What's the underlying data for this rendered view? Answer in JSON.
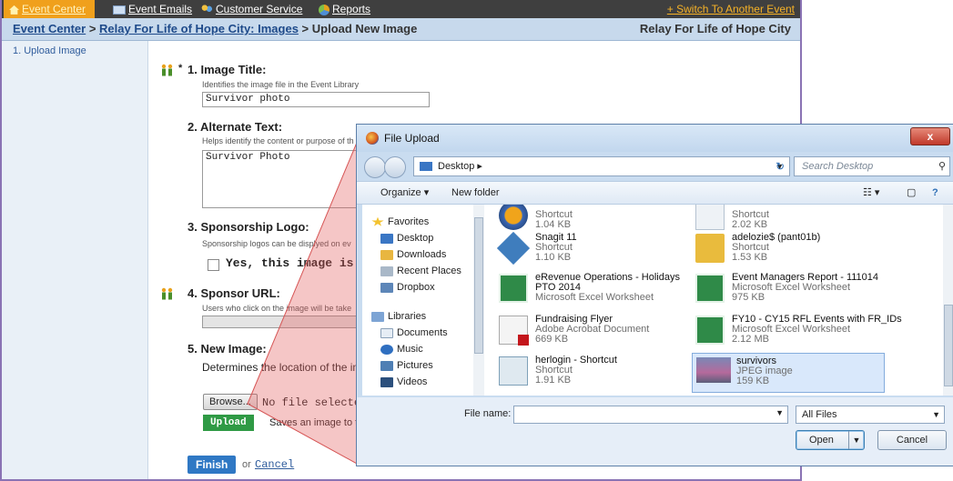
{
  "nav": {
    "items": [
      "Event Center",
      "Event Emails",
      "Customer Service",
      "Reports"
    ],
    "switch_label": "+ Switch To Another Event"
  },
  "breadcrumb": {
    "part1": "Event Center",
    "sep1": ">",
    "part2": "Relay For Life of Hope City: Images",
    "part3": "> Upload New Image",
    "event_name": "Relay For Life of Hope City"
  },
  "sidebar": {
    "items": [
      "1. Upload Image"
    ]
  },
  "form": {
    "f1_req": "*",
    "f1_label": "1. Image Title:",
    "f1_hint": "Identifies the image file in the Event Library",
    "f1_value": "Survivor photo",
    "f2_label": "2. Alternate Text:",
    "f2_hint": "Helps identify the content or purpose of th",
    "f2_value": "Survivor Photo",
    "f3_label": "3. Sponsorship Logo:",
    "f3_hint": "Sponsorship logos can be displyed on ev",
    "f3_checkbox": "Yes, this image is a spo",
    "f4_label": "4. Sponsor URL:",
    "f4_hint": "Users who click on the image will be take",
    "f5_label": "5. New Image:",
    "f5_hint": "Determines the location of the imag",
    "browse_label": "Browse...",
    "no_file": "No file selected.",
    "upload_label": "Upload",
    "upload_hint": "Saves an image to t",
    "finish_label": "Finish",
    "or_text": "or",
    "cancel_label": "Cancel"
  },
  "dialog": {
    "title": "File Upload",
    "close_label": "x",
    "address": "Desktop ▸",
    "search_placeholder": "Search Desktop",
    "organize_label": "Organize ▾",
    "new_folder_label": "New folder",
    "nav_pane": {
      "favorites": "Favorites",
      "items": [
        "Desktop",
        "Downloads",
        "Recent Places",
        "Dropbox"
      ],
      "libraries": "Libraries",
      "library_items": [
        "Documents",
        "Music",
        "Pictures",
        "Videos"
      ]
    },
    "files": [
      {
        "name": "",
        "type": "Shortcut",
        "size": "1.04 KB",
        "icon": "firefox-shortcut-icon"
      },
      {
        "name": "",
        "type": "Shortcut",
        "size": "2.02 KB",
        "icon": "shortcut-icon"
      },
      {
        "name": "Snagit 11",
        "type": "Shortcut",
        "size": "1.10 KB",
        "icon": "snagit-icon"
      },
      {
        "name": "adelozie$ (pant01b)",
        "type": "Shortcut",
        "size": "1.53 KB",
        "icon": "network-folder-icon"
      },
      {
        "name": "eRevenue Operations - Holidays",
        "type": "PTO 2014",
        "size": "Microsoft Excel Worksheet",
        "icon": "excel-icon"
      },
      {
        "name": "Event Managers Report - 111014",
        "type": "Microsoft Excel Worksheet",
        "size": "975 KB",
        "icon": "excel-icon"
      },
      {
        "name": "Fundraising Flyer",
        "type": "Adobe Acrobat Document",
        "size": "669 KB",
        "icon": "pdf-icon"
      },
      {
        "name": "FY10 - CY15 RFL Events with FR_IDs",
        "type": "Microsoft Excel Worksheet",
        "size": "2.12 MB",
        "icon": "excel-icon"
      },
      {
        "name": "herlogin - Shortcut",
        "type": "Shortcut",
        "size": "1.91 KB",
        "icon": "script-shortcut-icon"
      },
      {
        "name": "survivors",
        "type": "JPEG image",
        "size": "159 KB",
        "icon": "photo-thumbnail"
      }
    ],
    "file_name_label": "File name:",
    "file_name_value": "",
    "filter": "All Files",
    "open_label": "Open",
    "cancel_label": "Cancel"
  }
}
